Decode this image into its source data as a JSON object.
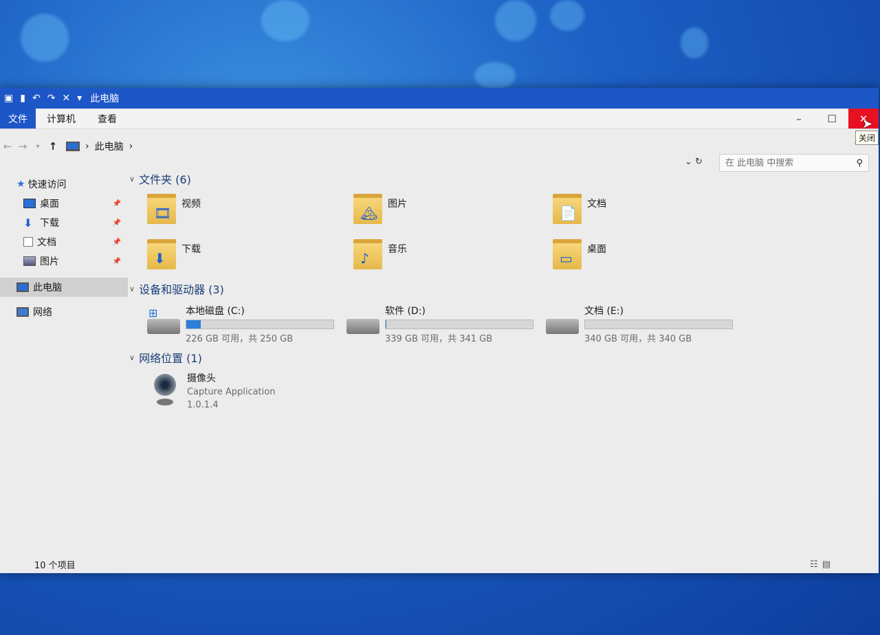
{
  "window": {
    "title": "此电脑"
  },
  "ribbon": {
    "tabs": [
      {
        "label": "文件",
        "active": true
      },
      {
        "label": "计算机"
      },
      {
        "label": "查看"
      }
    ],
    "close_tooltip": "关闭"
  },
  "address": {
    "location": "此电脑",
    "tail_glyph": "⌄ ↻"
  },
  "search": {
    "placeholder": "在 此电脑 中搜索"
  },
  "sidebar": {
    "quick_access": "快速访问",
    "pinned": [
      {
        "label": "桌面"
      },
      {
        "label": "下载"
      },
      {
        "label": "文档"
      },
      {
        "label": "图片"
      }
    ],
    "this_pc": "此电脑",
    "network": "网络"
  },
  "groups": {
    "folders": {
      "header": "文件夹 (6)",
      "items": [
        {
          "label": "视频",
          "icon": "video-folder-icon",
          "glyph": "🎞"
        },
        {
          "label": "图片",
          "icon": "pictures-folder-icon",
          "glyph": "🏔"
        },
        {
          "label": "文档",
          "icon": "documents-folder-icon",
          "glyph": "📄"
        },
        {
          "label": "下载",
          "icon": "downloads-folder-icon",
          "glyph": "⬇"
        },
        {
          "label": "音乐",
          "icon": "music-folder-icon",
          "glyph": "♪"
        },
        {
          "label": "桌面",
          "icon": "desktop-folder-icon",
          "glyph": "▭"
        }
      ]
    },
    "drives": {
      "header": "设备和驱动器 (3)",
      "items": [
        {
          "name": "本地磁盘 (C:)",
          "free_text": "226 GB 可用，共 250 GB",
          "used_fraction": 0.096,
          "system": true
        },
        {
          "name": "软件 (D:)",
          "free_text": "339 GB 可用，共 341 GB",
          "used_fraction": 0.006,
          "system": false
        },
        {
          "name": "文档 (E:)",
          "free_text": "340 GB 可用，共 340 GB",
          "used_fraction": 0.0,
          "system": false
        }
      ]
    },
    "network": {
      "header": "网络位置 (1)",
      "items": [
        {
          "name": "摄像头",
          "sub1": "Capture Application",
          "sub2": "1.0.1.4"
        }
      ]
    }
  },
  "status": {
    "items_count": "10 个项目"
  }
}
